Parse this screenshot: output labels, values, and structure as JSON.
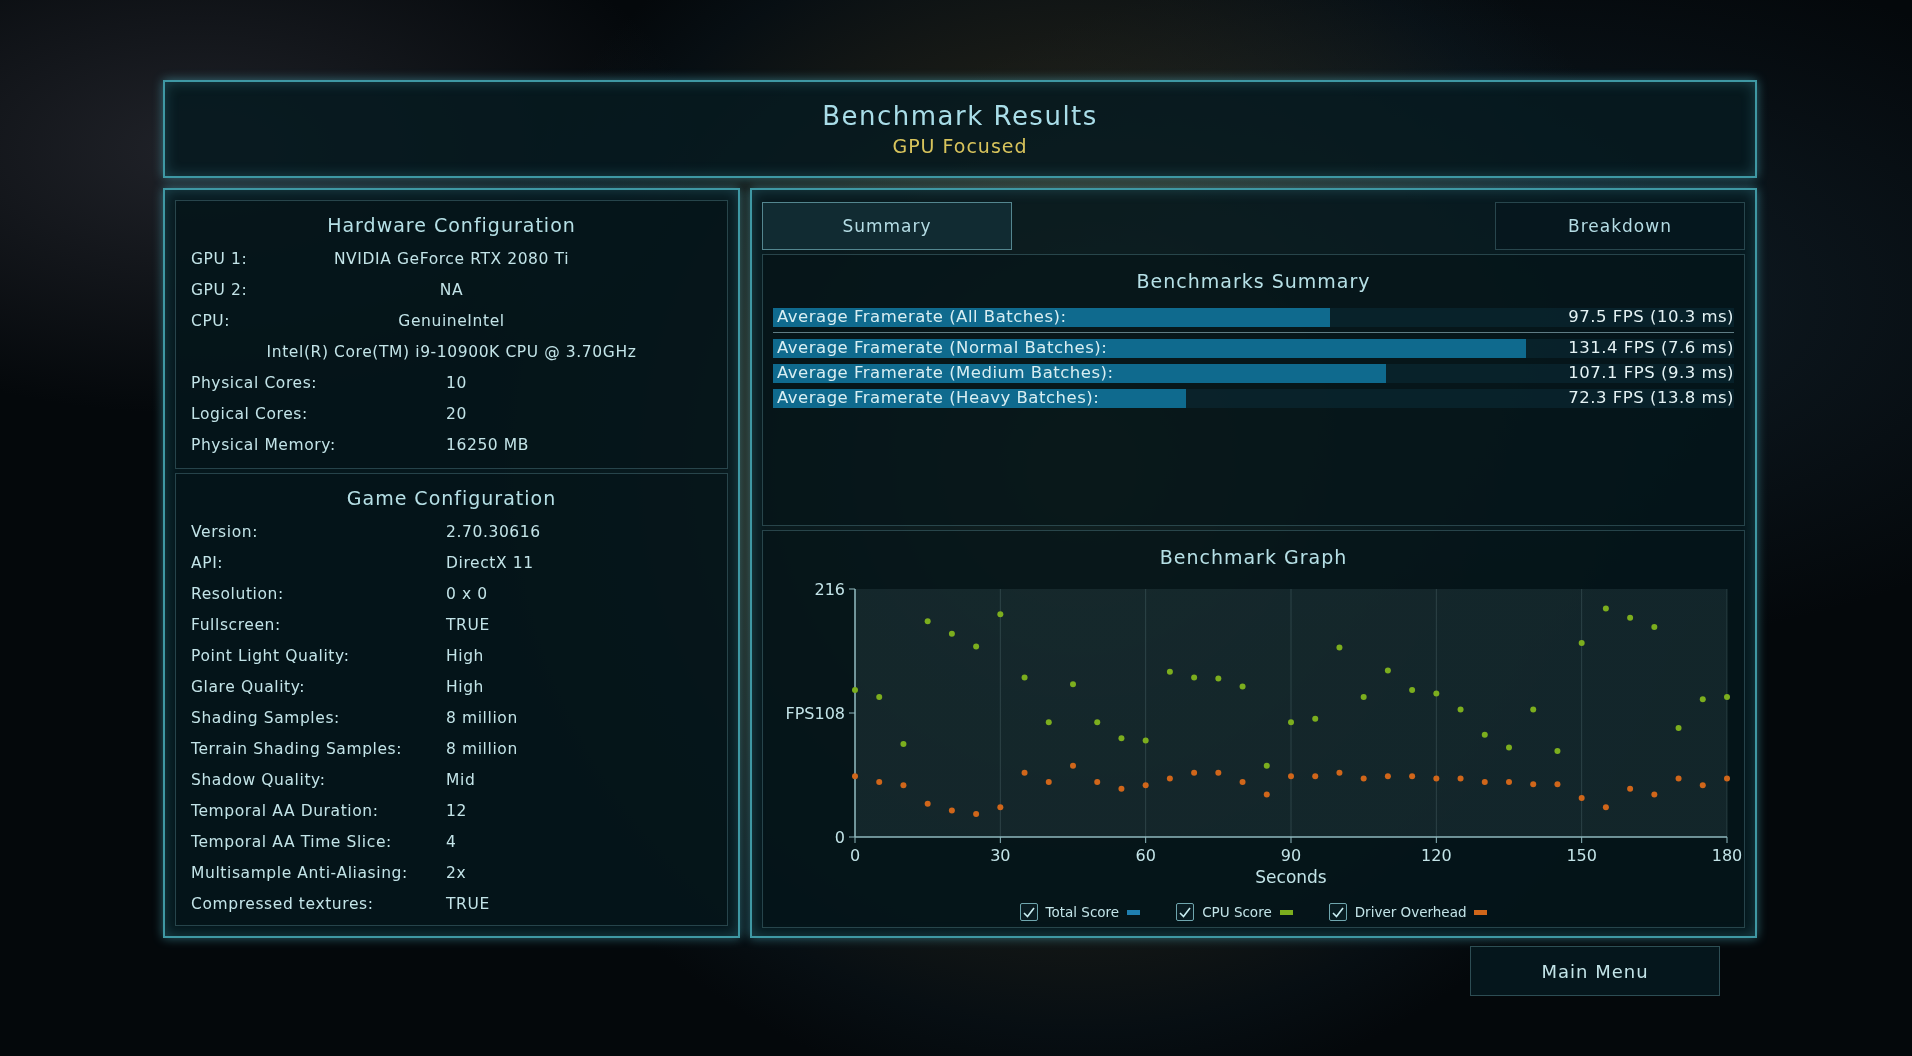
{
  "header": {
    "title": "Benchmark Results",
    "subtitle": "GPU Focused"
  },
  "hardware": {
    "title": "Hardware Configuration",
    "rows": [
      {
        "kind": "centered",
        "label": "GPU 1:",
        "value": "NVIDIA GeForce RTX 2080 Ti"
      },
      {
        "kind": "centered",
        "label": "GPU 2:",
        "value": "NA"
      },
      {
        "kind": "centered",
        "label": "CPU:",
        "value": "GenuineIntel"
      },
      {
        "kind": "continuation",
        "value": "Intel(R) Core(TM) i9-10900K CPU @ 3.70GHz"
      },
      {
        "kind": "pair",
        "label": "Physical Cores:",
        "value": "10"
      },
      {
        "kind": "pair",
        "label": "Logical Cores:",
        "value": "20"
      },
      {
        "kind": "pair",
        "label": "Physical Memory:",
        "value": "16250  MB"
      }
    ]
  },
  "game": {
    "title": "Game Configuration",
    "rows": [
      {
        "kind": "pair",
        "label": "Version:",
        "value": "2.70.30616"
      },
      {
        "kind": "pair",
        "label": "API:",
        "value": "DirectX 11"
      },
      {
        "kind": "pair",
        "label": "Resolution:",
        "value": "0 x 0"
      },
      {
        "kind": "pair",
        "label": "Fullscreen:",
        "value": "TRUE"
      },
      {
        "kind": "pair",
        "label": "Point Light Quality:",
        "value": "High"
      },
      {
        "kind": "pair",
        "label": "Glare Quality:",
        "value": "High"
      },
      {
        "kind": "pair",
        "label": "Shading Samples:",
        "value": "8 million"
      },
      {
        "kind": "pair",
        "label": "Terrain Shading Samples:",
        "value": "8 million"
      },
      {
        "kind": "pair",
        "label": "Shadow Quality:",
        "value": "Mid"
      },
      {
        "kind": "pair",
        "label": "Temporal AA Duration:",
        "value": "12"
      },
      {
        "kind": "pair",
        "label": "Temporal AA Time Slice:",
        "value": "4"
      },
      {
        "kind": "pair",
        "label": "Multisample Anti-Aliasing:",
        "value": "2x"
      },
      {
        "kind": "pair",
        "label": "Compressed textures:",
        "value": "TRUE"
      }
    ]
  },
  "tabs": [
    {
      "label": "Summary",
      "selected": true
    },
    {
      "label": "Breakdown",
      "selected": false
    }
  ],
  "summary": {
    "title": "Benchmarks Summary",
    "rows": [
      {
        "kind": "total",
        "label": "Average Framerate (All Batches):",
        "value": "97.5 FPS (10.3 ms)",
        "level": 0.58
      },
      {
        "kind": "batch",
        "label": "Average Framerate (Normal Batches):",
        "value": "131.4 FPS (7.6 ms)",
        "level": 0.784
      },
      {
        "kind": "batch",
        "label": "Average Framerate (Medium Batches):",
        "value": "107.1 FPS (9.3 ms)",
        "level": 0.638
      },
      {
        "kind": "batch",
        "label": "Average Framerate (Heavy Batches):",
        "value": "72.3 FPS (13.8 ms)",
        "level": 0.43
      }
    ]
  },
  "graph": {
    "title": "Benchmark Graph",
    "chart_data": {
      "type": "scatter",
      "grid": true,
      "xlabel": "Seconds",
      "xlim": [
        0,
        180
      ],
      "ylim": [
        0,
        216
      ],
      "xticks": [
        0,
        30,
        60,
        90,
        120,
        150,
        180
      ],
      "yticks": [
        0,
        {
          "value": 108,
          "label": "FPS108"
        },
        216
      ],
      "x": [
        0,
        5,
        10,
        15,
        20,
        25,
        30,
        35,
        40,
        45,
        50,
        55,
        60,
        65,
        70,
        75,
        80,
        85,
        90,
        95,
        100,
        105,
        110,
        115,
        120,
        125,
        130,
        135,
        140,
        145,
        150,
        155,
        160,
        165,
        170,
        175,
        180
      ],
      "series": [
        {
          "name": "Total Score",
          "color": "#1f7fb0",
          "values": [
            null,
            null,
            null,
            null,
            null,
            null,
            null,
            null,
            null,
            null,
            null,
            null,
            null,
            null,
            null,
            null,
            null,
            null,
            null,
            null,
            null,
            null,
            null,
            null,
            null,
            null,
            null,
            null,
            null,
            null,
            null,
            null,
            null,
            null,
            null,
            null,
            null
          ]
        },
        {
          "name": "CPU Score",
          "color": "#7cae1e",
          "values": [
            128,
            122,
            81,
            188,
            177,
            166,
            194,
            139,
            100,
            133,
            100,
            86,
            84,
            144,
            139,
            138,
            131,
            62,
            100,
            103,
            165,
            122,
            145,
            128,
            125,
            111,
            89,
            78,
            111,
            75,
            169,
            199,
            191,
            183,
            95,
            120,
            122
          ]
        },
        {
          "name": "Driver Overhead",
          "color": "#d0661a",
          "values": [
            53,
            48,
            45,
            29,
            23,
            20,
            26,
            56,
            48,
            62,
            48,
            42,
            45,
            51,
            56,
            56,
            48,
            37,
            53,
            53,
            56,
            51,
            53,
            53,
            51,
            51,
            48,
            48,
            46,
            46,
            34,
            26,
            42,
            37,
            51,
            45,
            51
          ]
        }
      ]
    },
    "legend": [
      {
        "checked": true
      },
      {
        "checked": true
      },
      {
        "checked": true
      }
    ]
  },
  "main_menu": {
    "label": "Main Menu"
  }
}
